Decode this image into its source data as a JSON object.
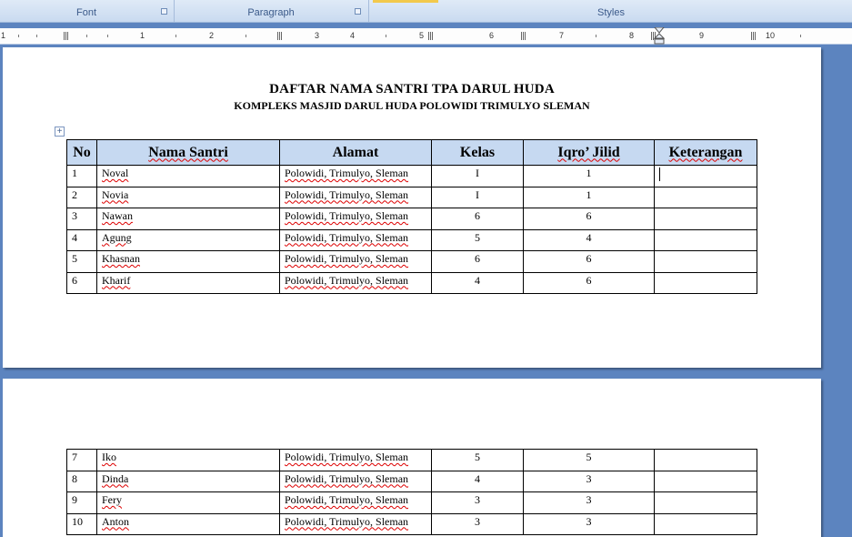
{
  "ribbon": {
    "groups": [
      {
        "label": "Font"
      },
      {
        "label": "Paragraph"
      },
      {
        "label": "Styles"
      }
    ]
  },
  "ruler": {
    "numbers": [
      "1",
      "1",
      "2",
      "3",
      "4",
      "5",
      "6",
      "7",
      "8",
      "9",
      "10"
    ]
  },
  "document": {
    "title": "DAFTAR NAMA SANTRI  TPA DARUL HUDA",
    "subtitle": "KOMPLEKS MASJID DARUL HUDA POLOWIDI TRIMULYO SLEMAN",
    "headers": [
      "No",
      "Nama Santri",
      "Alamat",
      "Kelas",
      "Iqro’ Jilid",
      "Keterangan"
    ],
    "page1_rows": [
      {
        "no": "1",
        "nama": "Noval",
        "alamat": "Polowidi, Trimulyo, Sleman",
        "kelas": "I",
        "jilid": "1",
        "ket": ""
      },
      {
        "no": "2",
        "nama": "Novia",
        "alamat": "Polowidi, Trimulyo, Sleman",
        "kelas": "I",
        "jilid": "1",
        "ket": ""
      },
      {
        "no": "3",
        "nama": "Nawan",
        "alamat": "Polowidi, Trimulyo, Sleman",
        "kelas": "6",
        "jilid": "6",
        "ket": ""
      },
      {
        "no": "4",
        "nama": "Agung",
        "alamat": "Polowidi, Trimulyo, Sleman",
        "kelas": "5",
        "jilid": "4",
        "ket": ""
      },
      {
        "no": "5",
        "nama": "Khasnan",
        "alamat": "Polowidi, Trimulyo, Sleman",
        "kelas": "6",
        "jilid": "6",
        "ket": ""
      },
      {
        "no": "6",
        "nama": "Kharif",
        "alamat": "Polowidi, Trimulyo, Sleman",
        "kelas": "4",
        "jilid": "6",
        "ket": ""
      }
    ],
    "page2_rows": [
      {
        "no": "7",
        "nama": "Iko",
        "alamat": "Polowidi, Trimulyo, Sleman",
        "kelas": "5",
        "jilid": "5",
        "ket": ""
      },
      {
        "no": "8",
        "nama": "Dinda",
        "alamat": "Polowidi, Trimulyo, Sleman",
        "kelas": "4",
        "jilid": "3",
        "ket": ""
      },
      {
        "no": "9",
        "nama": "Fery",
        "alamat": "Polowidi, Trimulyo, Sleman",
        "kelas": "3",
        "jilid": "3",
        "ket": ""
      },
      {
        "no": "10",
        "nama": "Anton",
        "alamat": "Polowidi, Trimulyo, Sleman",
        "kelas": "3",
        "jilid": "3",
        "ket": ""
      }
    ]
  },
  "colors": {
    "header_fill": "#c6d9f1",
    "workspace": "#5c84bf",
    "spell_underline": "#dd0000"
  }
}
